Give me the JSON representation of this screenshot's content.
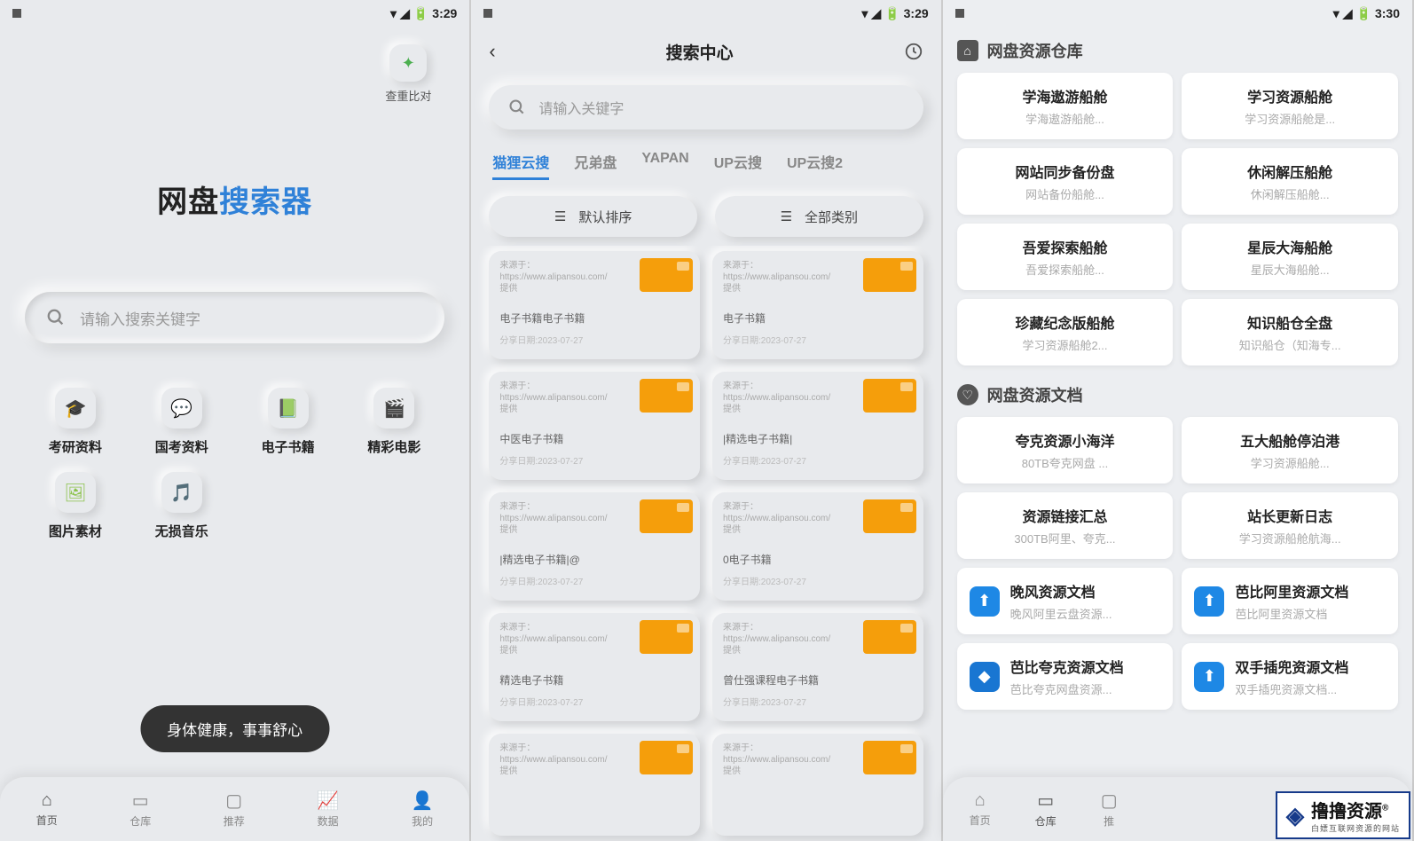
{
  "status": {
    "time1": "3:29",
    "time2": "3:29",
    "time3": "3:30"
  },
  "phone1": {
    "chip_label": "查重比对",
    "title_a": "网盘",
    "title_b": "搜索器",
    "search_placeholder": "请输入搜索关键字",
    "categories": [
      {
        "label": "考研资料",
        "icon": "🎓",
        "color": "#f0b429"
      },
      {
        "label": "国考资料",
        "icon": "💬",
        "color": "#2f81d8"
      },
      {
        "label": "电子书籍",
        "icon": "📗",
        "color": "#4caf50"
      },
      {
        "label": "精彩电影",
        "icon": "🎬",
        "color": "#2f81d8"
      },
      {
        "label": "图片素材",
        "icon": "🖼",
        "color": "#8bc34a"
      },
      {
        "label": "无损音乐",
        "icon": "🎵",
        "color": "#2f81d8"
      }
    ],
    "toast": "身体健康，事事舒心",
    "nav": [
      "首页",
      "仓库",
      "推荐",
      "数据",
      "我的"
    ]
  },
  "phone2": {
    "header_title": "搜索中心",
    "search_placeholder": "请输入关键字",
    "tabs": [
      "猫狸云搜",
      "兄弟盘",
      "YAPAN",
      "UP云搜",
      "UP云搜2"
    ],
    "filter_sort": "默认排序",
    "filter_cat": "全部类别",
    "source_text": "来源于：https://www.alipansou.com/提供",
    "date_prefix": "分享日期:",
    "results": [
      {
        "name": "电子书籍电子书籍",
        "date": "2023-07-27"
      },
      {
        "name": "电子书籍",
        "date": "2023-07-27"
      },
      {
        "name": "中医电子书籍",
        "date": "2023-07-27"
      },
      {
        "name": "|精选电子书籍|",
        "date": "2023-07-27"
      },
      {
        "name": "|精选电子书籍|@",
        "date": "2023-07-27"
      },
      {
        "name": "0电子书籍",
        "date": "2023-07-27"
      },
      {
        "name": "精选电子书籍",
        "date": "2023-07-27"
      },
      {
        "name": "曾仕强课程电子书籍",
        "date": "2023-07-27"
      },
      {
        "name": "",
        "date": ""
      },
      {
        "name": "",
        "date": ""
      }
    ]
  },
  "phone3": {
    "section1_title": "网盘资源仓库",
    "section2_title": "网盘资源文档",
    "warehouse": [
      {
        "t1": "学海遨游船舱",
        "t2": "学海遨游船舱..."
      },
      {
        "t1": "学习资源船舱",
        "t2": "学习资源船舱是..."
      },
      {
        "t1": "网站同步备份盘",
        "t2": "网站备份船舱..."
      },
      {
        "t1": "休闲解压船舱",
        "t2": "休闲解压船舱..."
      },
      {
        "t1": "吾爱探索船舱",
        "t2": "吾爱探索船舱..."
      },
      {
        "t1": "星辰大海船舱",
        "t2": "星辰大海船舱..."
      },
      {
        "t1": "珍藏纪念版船舱",
        "t2": "学习资源船舱2..."
      },
      {
        "t1": "知识船仓全盘",
        "t2": "知识船仓（知海专..."
      }
    ],
    "docs": [
      {
        "t1": "夸克资源小海洋",
        "t2": "80TB夸克网盘  ...",
        "icon": ""
      },
      {
        "t1": "五大船舱停泊港",
        "t2": "学习资源船舱...",
        "icon": ""
      },
      {
        "t1": "资源链接汇总",
        "t2": "300TB阿里、夸克...",
        "icon": ""
      },
      {
        "t1": "站长更新日志",
        "t2": "学习资源船舱航海...",
        "icon": ""
      },
      {
        "t1": "晚风资源文档",
        "t2": "晚风阿里云盘资源...",
        "icon": "doc",
        "color": "#1e88e5"
      },
      {
        "t1": "芭比阿里资源文档",
        "t2": "芭比阿里资源文档",
        "icon": "doc",
        "color": "#1e88e5"
      },
      {
        "t1": "芭比夸克资源文档",
        "t2": "芭比夸克网盘资源...",
        "icon": "cube",
        "color": "#1976d2"
      },
      {
        "t1": "双手插兜资源文档",
        "t2": "双手插兜资源文档...",
        "icon": "doc",
        "color": "#1e88e5"
      }
    ],
    "nav": [
      "首页",
      "仓库",
      "推"
    ]
  },
  "watermark": {
    "line1": "撸撸资源",
    "reg": "®",
    "line2": "白嫖互联网资源的网站"
  }
}
